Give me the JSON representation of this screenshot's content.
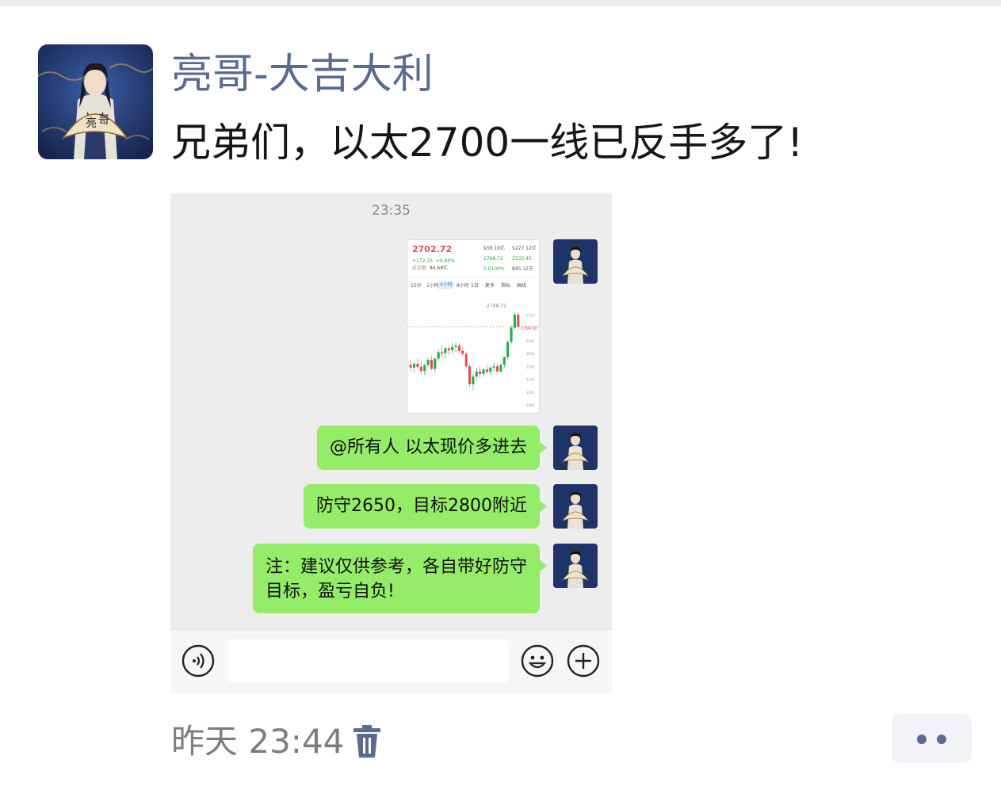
{
  "post": {
    "author": "亮哥-大吉大利",
    "text": "兄弟们，以太2700一线已反手多了!",
    "time_label": "昨天 23:44"
  },
  "screenshot": {
    "timestamp": "23:35",
    "image_message": {
      "price": "2702.72",
      "change": "+172.25",
      "change_pct": "+6.80%",
      "volume_label": "成交额",
      "volume": "84.68亿",
      "stats": [
        "$58.19亿",
        "$227.12亿",
        "2798.72",
        "2532.45",
        "0.0100%",
        "845.12万"
      ],
      "tabs": [
        "15分",
        "1小时",
        "4小时",
        "8小时",
        "1日",
        "更多",
        "指标",
        "画线"
      ],
      "active_tab": "4小时",
      "high_marker": "2798.72",
      "price_line": "2704.60",
      "y_ticks": [
        "2750",
        "2700",
        "2650",
        "2600",
        "2550",
        "2500",
        "2450",
        "2400"
      ],
      "candles": [
        {
          "o": 2555,
          "h": 2575,
          "l": 2530,
          "c": 2545
        },
        {
          "o": 2545,
          "h": 2565,
          "l": 2525,
          "c": 2560
        },
        {
          "o": 2560,
          "h": 2580,
          "l": 2540,
          "c": 2548
        },
        {
          "o": 2548,
          "h": 2570,
          "l": 2520,
          "c": 2532
        },
        {
          "o": 2532,
          "h": 2560,
          "l": 2515,
          "c": 2555
        },
        {
          "o": 2555,
          "h": 2585,
          "l": 2545,
          "c": 2575
        },
        {
          "o": 2575,
          "h": 2590,
          "l": 2535,
          "c": 2540
        },
        {
          "o": 2540,
          "h": 2585,
          "l": 2525,
          "c": 2580
        },
        {
          "o": 2580,
          "h": 2615,
          "l": 2570,
          "c": 2605
        },
        {
          "o": 2605,
          "h": 2630,
          "l": 2585,
          "c": 2600
        },
        {
          "o": 2600,
          "h": 2625,
          "l": 2580,
          "c": 2620
        },
        {
          "o": 2620,
          "h": 2632,
          "l": 2595,
          "c": 2612
        },
        {
          "o": 2612,
          "h": 2640,
          "l": 2600,
          "c": 2625
        },
        {
          "o": 2625,
          "h": 2645,
          "l": 2605,
          "c": 2630
        },
        {
          "o": 2630,
          "h": 2640,
          "l": 2600,
          "c": 2610
        },
        {
          "o": 2610,
          "h": 2625,
          "l": 2590,
          "c": 2598
        },
        {
          "o": 2598,
          "h": 2605,
          "l": 2540,
          "c": 2550
        },
        {
          "o": 2550,
          "h": 2560,
          "l": 2470,
          "c": 2480
        },
        {
          "o": 2480,
          "h": 2520,
          "l": 2455,
          "c": 2510
        },
        {
          "o": 2510,
          "h": 2545,
          "l": 2495,
          "c": 2530
        },
        {
          "o": 2530,
          "h": 2548,
          "l": 2505,
          "c": 2520
        },
        {
          "o": 2520,
          "h": 2545,
          "l": 2510,
          "c": 2538
        },
        {
          "o": 2538,
          "h": 2555,
          "l": 2520,
          "c": 2528
        },
        {
          "o": 2528,
          "h": 2550,
          "l": 2515,
          "c": 2545
        },
        {
          "o": 2545,
          "h": 2565,
          "l": 2530,
          "c": 2550
        },
        {
          "o": 2550,
          "h": 2560,
          "l": 2520,
          "c": 2530
        },
        {
          "o": 2530,
          "h": 2560,
          "l": 2525,
          "c": 2555
        },
        {
          "o": 2555,
          "h": 2590,
          "l": 2545,
          "c": 2585
        },
        {
          "o": 2585,
          "h": 2650,
          "l": 2575,
          "c": 2645
        },
        {
          "o": 2645,
          "h": 2710,
          "l": 2635,
          "c": 2700
        },
        {
          "o": 2700,
          "h": 2760,
          "l": 2690,
          "c": 2750
        },
        {
          "o": 2750,
          "h": 2760,
          "l": 2698,
          "c": 2704
        }
      ]
    },
    "messages": [
      {
        "text": "@所有人 以太现价多进去"
      },
      {
        "text": "防守2650，目标2800附近"
      },
      {
        "line1": "注：建议仅供参考，各自带好防守",
        "line2": "目标，盈亏自负!"
      }
    ]
  },
  "colors": {
    "author": "#5b6a92",
    "bubble": "#95ec69",
    "up": "#2aa84a",
    "down": "#d9534f"
  },
  "icons": {
    "voice": "voice-icon",
    "emoji": "emoji-icon",
    "add": "plus-icon",
    "delete": "trash-icon",
    "more": "more-dots-icon"
  }
}
